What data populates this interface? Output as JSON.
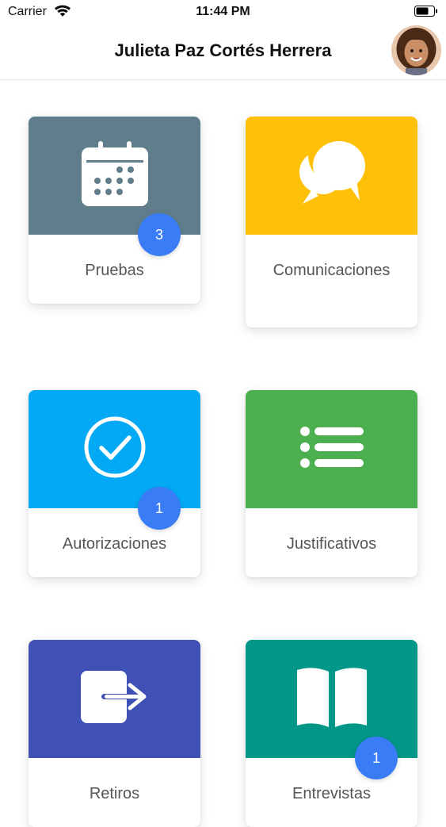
{
  "status": {
    "carrier": "Carrier",
    "time": "11:44 PM"
  },
  "header": {
    "title": "Julieta Paz Cortés Herrera"
  },
  "tiles": [
    {
      "label": "Pruebas",
      "icon": "calendar-icon",
      "color": "#607d8b",
      "badge": "3"
    },
    {
      "label": "Comunicaciones",
      "icon": "chat-bubbles-icon",
      "color": "#ffc107",
      "badge": ""
    },
    {
      "label": "Autorizaciones",
      "icon": "check-circle-icon",
      "color": "#03a9f4",
      "badge": "1"
    },
    {
      "label": "Justificativos",
      "icon": "list-icon",
      "color": "#4caf50",
      "badge": ""
    },
    {
      "label": "Retiros",
      "icon": "exit-icon",
      "color": "#3f51b5",
      "badge": ""
    },
    {
      "label": "Entrevistas",
      "icon": "book-icon",
      "color": "#009688",
      "badge": "1"
    }
  ],
  "colors": {
    "badge": "#3a7cf6"
  }
}
